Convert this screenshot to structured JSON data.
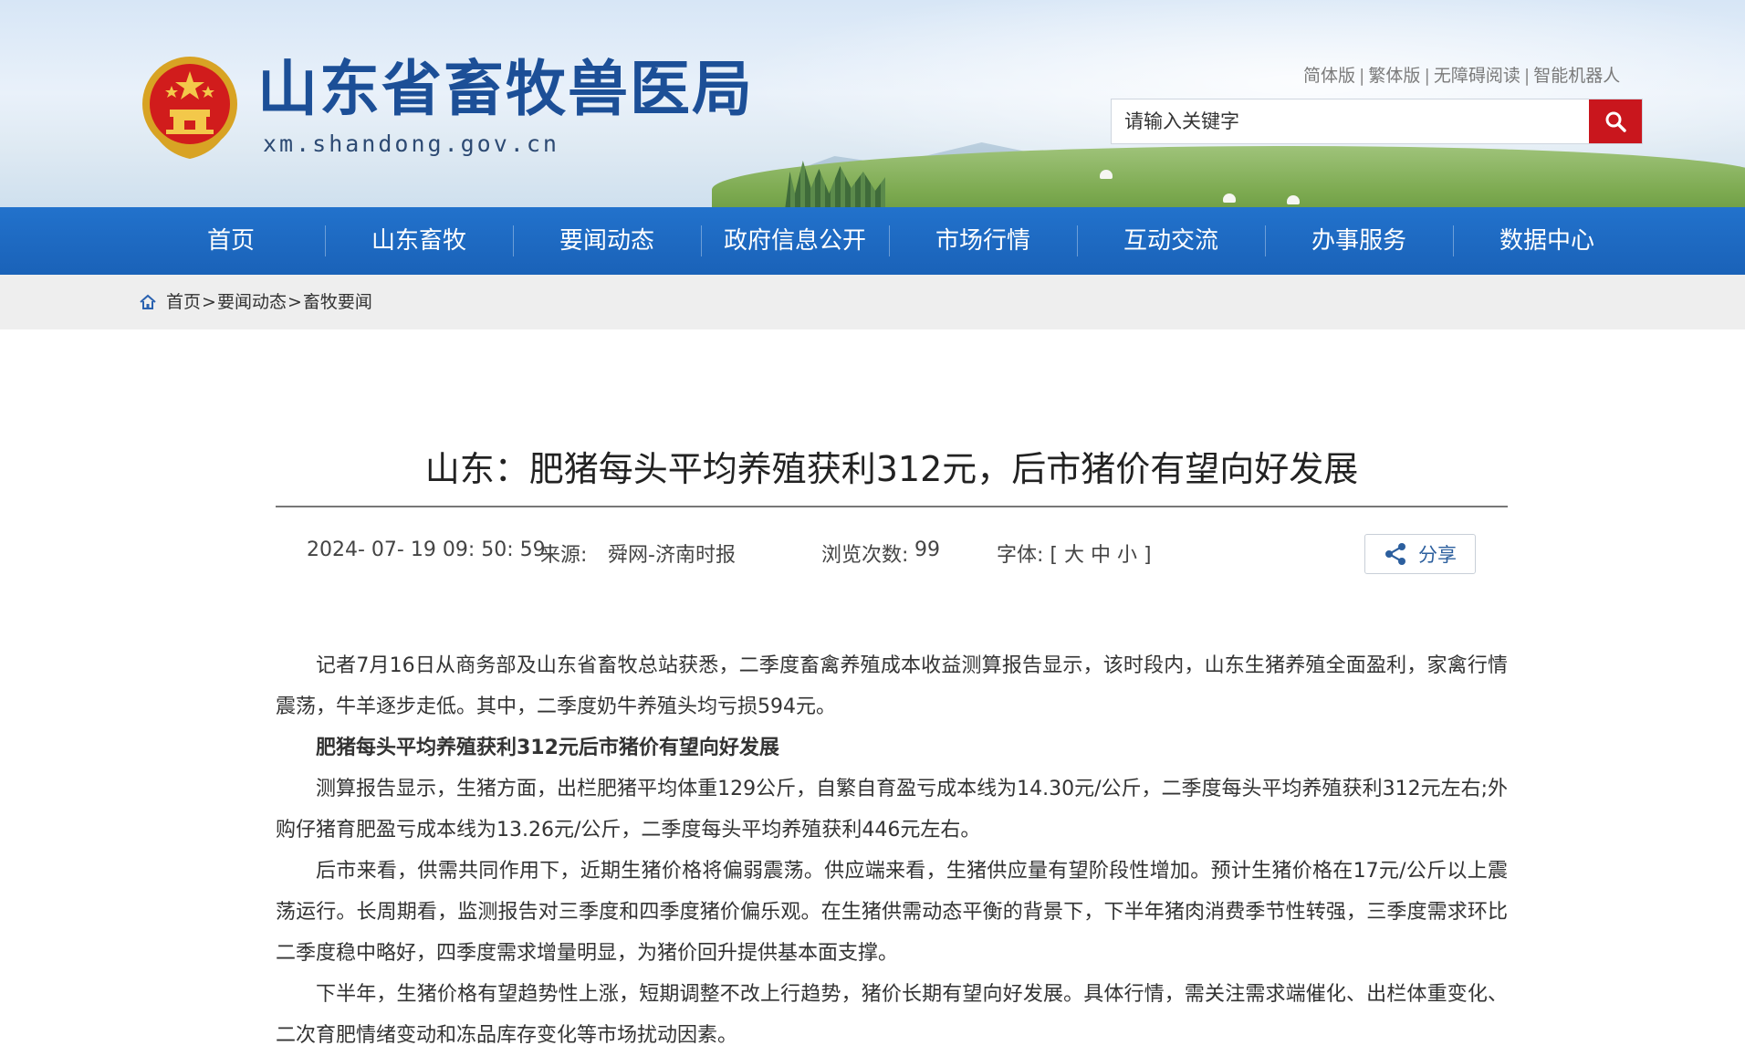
{
  "header": {
    "site_title": "山东省畜牧兽医局",
    "site_url": "xm.shandong.gov.cn",
    "links": [
      "简体版",
      "繁体版",
      "无障碍阅读",
      "智能机器人"
    ],
    "search_placeholder": "请输入关键字",
    "emblem_icon": "national-emblem",
    "search_icon": "magnifier-icon",
    "accent_color": "#c9161d",
    "brand_color": "#1c4f97"
  },
  "nav": {
    "items": [
      "首页",
      "山东畜牧",
      "要闻动态",
      "政府信息公开",
      "市场行情",
      "互动交流",
      "办事服务",
      "数据中心"
    ],
    "color": "#1f6ac3"
  },
  "breadcrumb": {
    "items": [
      "首页",
      "要闻动态",
      "畜牧要闻"
    ],
    "separator": ">",
    "icon": "home-icon"
  },
  "article": {
    "title": "山东：肥猪每头平均养殖获利312元，后市猪价有望向好发展",
    "date": "2024- 07- 19 09: 50: 59",
    "source_label": "来源:",
    "source": "舜网-济南时报",
    "views_label": "浏览次数:",
    "views": "99",
    "font_label": "字体: [ 大 中 小 ]",
    "share_label": "分享",
    "share_icon": "share-icon",
    "paragraphs": [
      "记者7月16日从商务部及山东省畜牧总站获悉，二季度畜禽养殖成本收益测算报告显示，该时段内，山东生猪养殖全面盈利，家禽行情震荡，牛羊逐步走低。其中，二季度奶牛养殖头均亏损594元。",
      "肥猪每头平均养殖获利312元后市猪价有望向好发展",
      "测算报告显示，生猪方面，出栏肥猪平均体重129公斤，自繁自育盈亏成本线为14.30元/公斤，二季度每头平均养殖获利312元左右;外购仔猪育肥盈亏成本线为13.26元/公斤，二季度每头平均养殖获利446元左右。",
      "后市来看，供需共同作用下，近期生猪价格将偏弱震荡。供应端来看，生猪供应量有望阶段性增加。预计生猪价格在17元/公斤以上震荡运行。长周期看，监测报告对三季度和四季度猪价偏乐观。在生猪供需动态平衡的背景下，下半年猪肉消费季节性转强，三季度需求环比二季度稳中略好，四季度需求增量明显，为猪价回升提供基本面支撑。",
      "下半年，生猪价格有望趋势性上涨，短期调整不改上行趋势，猪价长期有望向好发展。具体行情，需关注需求端催化、出栏体重变化、二次育肥情绪变动和冻品库存变化等市场扰动因素。"
    ]
  }
}
